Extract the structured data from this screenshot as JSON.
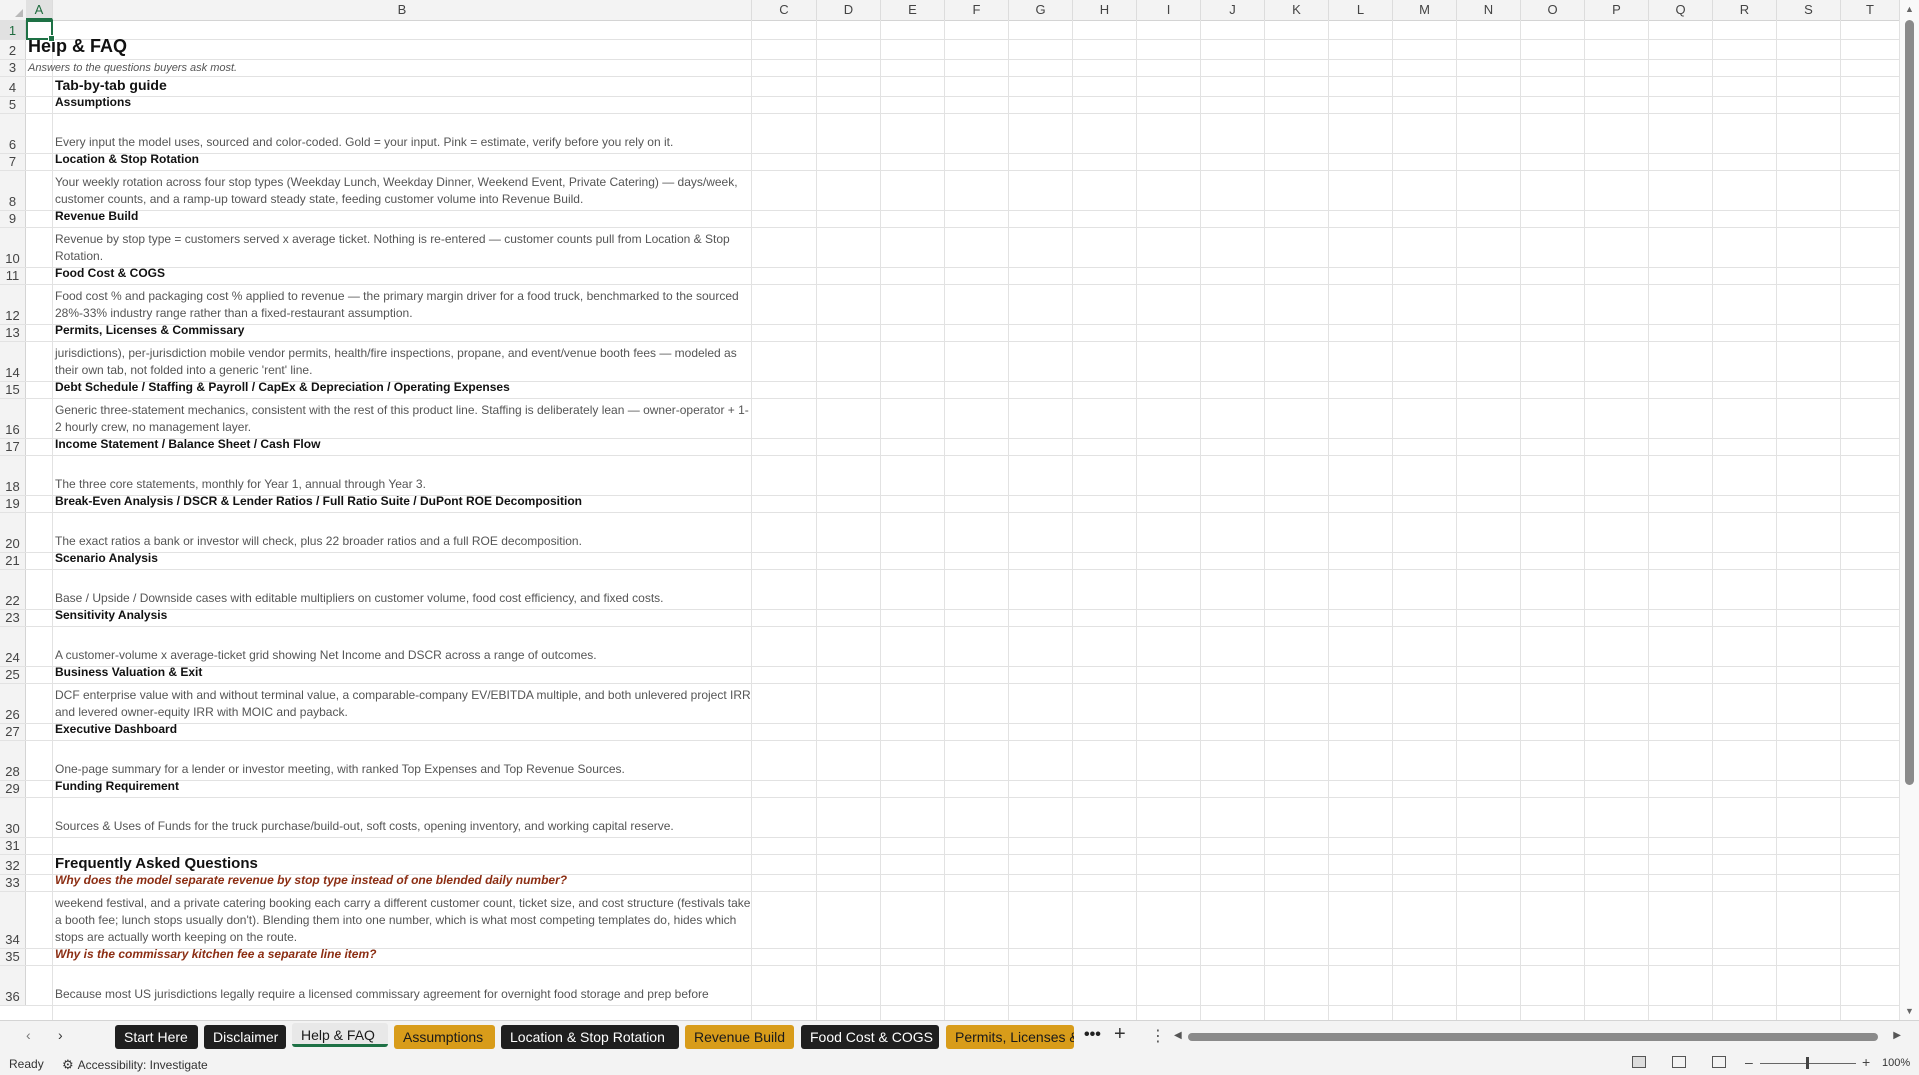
{
  "columns": [
    "A",
    "B",
    "C",
    "D",
    "E",
    "F",
    "G",
    "H",
    "I",
    "J",
    "K",
    "L",
    "M",
    "N",
    "O",
    "P",
    "Q",
    "R",
    "S",
    "T"
  ],
  "sheet": {
    "title": "Help & FAQ",
    "subtitle": "Answers to the questions buyers ask most.",
    "guide_heading": "Tab-by-tab guide",
    "faq_heading": "Frequently Asked Questions",
    "rows": [
      {
        "num": "1",
        "kind": "empty",
        "text": ""
      },
      {
        "num": "2",
        "kind": "title",
        "text": "Help & FAQ"
      },
      {
        "num": "3",
        "kind": "subtitle",
        "text": "Answers to the questions buyers ask most."
      },
      {
        "num": "4",
        "kind": "section",
        "text": "Tab-by-tab guide"
      },
      {
        "num": "5",
        "kind": "tab",
        "text": "Assumptions"
      },
      {
        "num": "6",
        "kind": "body",
        "text": "Every input the model uses, sourced and color-coded. Gold = your input. Pink = estimate, verify before you rely on it."
      },
      {
        "num": "7",
        "kind": "tab",
        "text": "Location & Stop Rotation"
      },
      {
        "num": "8",
        "kind": "body",
        "text": "Your weekly rotation across four stop types (Weekday Lunch, Weekday Dinner, Weekend Event, Private Catering) — days/week, customer counts, and a ramp-up toward steady state, feeding customer volume into Revenue Build."
      },
      {
        "num": "9",
        "kind": "tab",
        "text": "Revenue Build"
      },
      {
        "num": "10",
        "kind": "body",
        "text": "Revenue by stop type = customers served x average ticket. Nothing is re-entered — customer counts pull from Location & Stop Rotation."
      },
      {
        "num": "11",
        "kind": "tab",
        "text": "Food Cost & COGS"
      },
      {
        "num": "12",
        "kind": "body",
        "text": "Food cost % and packaging cost % applied to revenue — the primary margin driver for a food truck, benchmarked to the sourced 28%-33% industry range rather than a fixed-restaurant assumption."
      },
      {
        "num": "13",
        "kind": "tab",
        "text": "Permits, Licenses & Commissary"
      },
      {
        "num": "14",
        "kind": "body",
        "text": "jurisdictions), per-jurisdiction mobile vendor permits, health/fire inspections, propane, and event/venue booth fees — modeled as their own tab, not folded into a generic 'rent' line."
      },
      {
        "num": "15",
        "kind": "tab",
        "text": "Debt Schedule / Staffing & Payroll / CapEx & Depreciation / Operating Expenses"
      },
      {
        "num": "16",
        "kind": "body",
        "text": "Generic three-statement mechanics, consistent with the rest of this product line. Staffing is deliberately lean — owner-operator + 1-2 hourly crew, no management layer."
      },
      {
        "num": "17",
        "kind": "tab",
        "text": "Income Statement / Balance Sheet / Cash Flow"
      },
      {
        "num": "18",
        "kind": "body",
        "text": "The three core statements, monthly for Year 1, annual through Year 3."
      },
      {
        "num": "19",
        "kind": "tab",
        "text": "Break-Even Analysis / DSCR & Lender Ratios / Full Ratio Suite / DuPont ROE Decomposition"
      },
      {
        "num": "20",
        "kind": "body",
        "text": "The exact ratios a bank or investor will check, plus 22 broader ratios and a full ROE decomposition."
      },
      {
        "num": "21",
        "kind": "tab",
        "text": "Scenario Analysis"
      },
      {
        "num": "22",
        "kind": "body",
        "text": "Base / Upside / Downside cases with editable multipliers on customer volume, food cost efficiency, and fixed costs."
      },
      {
        "num": "23",
        "kind": "tab",
        "text": "Sensitivity Analysis"
      },
      {
        "num": "24",
        "kind": "body",
        "text": "A customer-volume x average-ticket grid showing Net Income and DSCR across a range of outcomes."
      },
      {
        "num": "25",
        "kind": "tab",
        "text": "Business Valuation & Exit"
      },
      {
        "num": "26",
        "kind": "body",
        "text": "DCF enterprise value with and without terminal value, a comparable-company EV/EBITDA multiple, and both unlevered project IRR and levered owner-equity IRR with MOIC and payback."
      },
      {
        "num": "27",
        "kind": "tab",
        "text": "Executive Dashboard"
      },
      {
        "num": "28",
        "kind": "body",
        "text": "One-page summary for a lender or investor meeting, with ranked Top Expenses and Top Revenue Sources."
      },
      {
        "num": "29",
        "kind": "tab",
        "text": "Funding Requirement"
      },
      {
        "num": "30",
        "kind": "body",
        "text": "Sources & Uses of Funds for the truck purchase/build-out, soft costs, opening inventory, and working capital reserve."
      },
      {
        "num": "31",
        "kind": "empty",
        "text": ""
      },
      {
        "num": "32",
        "kind": "faqhead",
        "text": "Frequently Asked Questions"
      },
      {
        "num": "33",
        "kind": "question",
        "text": "Why does the model separate revenue by stop type instead of one blended daily number?"
      },
      {
        "num": "34",
        "kind": "body",
        "text": "weekend festival, and a private catering booking each carry a different customer count, ticket size, and cost structure (festivals take a booth fee; lunch stops usually don't). Blending them into one number, which is what most competing templates do, hides which stops are actually worth keeping on the route."
      },
      {
        "num": "35",
        "kind": "question",
        "text": "Why is the commissary kitchen fee a separate line item?"
      },
      {
        "num": "36",
        "kind": "body",
        "text": "Because most US jurisdictions legally require a licensed commissary agreement for overnight food storage and prep before"
      }
    ]
  },
  "sheet_tabs": [
    {
      "label": "Start Here",
      "style": "dark"
    },
    {
      "label": "Disclaimer",
      "style": "dark"
    },
    {
      "label": "Help & FAQ",
      "style": "active"
    },
    {
      "label": "Assumptions",
      "style": "gold"
    },
    {
      "label": "Location & Stop Rotation",
      "style": "dark"
    },
    {
      "label": "Revenue Build",
      "style": "gold"
    },
    {
      "label": "Food Cost & COGS",
      "style": "dark"
    },
    {
      "label": "Permits, Licenses &",
      "style": "gold"
    }
  ],
  "tabbar": {
    "more": "•••",
    "add": "+",
    "menu": "⋮"
  },
  "status": {
    "ready": "Ready",
    "accessibility": "Accessibility: Investigate",
    "zoom": "100%"
  },
  "icons": {
    "prev": "chevron-left-icon",
    "next": "chevron-right-icon",
    "accessibility": "accessibility-icon",
    "normal_view": "normal-view-icon",
    "page_layout": "page-layout-icon",
    "page_break": "page-break-icon"
  },
  "colors": {
    "accent": "#1e7145",
    "tab_dark": "#1f1f1f",
    "tab_gold": "#d89c1a",
    "question": "#8b2d12"
  }
}
